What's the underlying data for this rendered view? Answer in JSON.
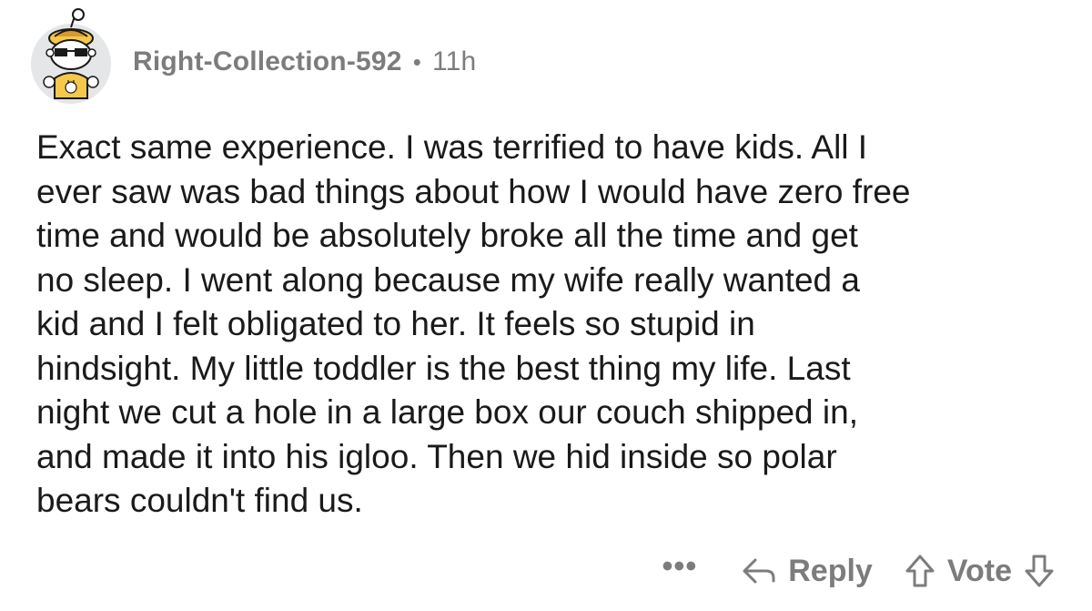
{
  "comment": {
    "author": "Right-Collection-592",
    "separator": "•",
    "age": "11h",
    "body": "Exact same experience. I was terrified to have kids. All I\never saw was bad things about how I would have zero free\ntime and would be absolutely broke all the time and get\nno sleep. I went along because my wife really wanted a\nkid and I felt obligated to her. It feels so stupid in\nhindsight. My little toddler is the best thing my life. Last\nnight we cut a hole in a large box our couch shipped in,\nand made it into his igloo. Then we hid inside so polar\nbears couldn't find us."
  },
  "actions": {
    "more_label": "•••",
    "reply_label": "Reply",
    "vote_label": "Vote"
  },
  "icons": {
    "avatar": "snoo-avatar",
    "reply": "reply-arrow-icon",
    "upvote": "upvote-arrow-icon",
    "downvote": "downvote-arrow-icon"
  },
  "colors": {
    "text": "#1a1a1b",
    "meta": "#7c7c7c",
    "avatar_bg": "#e4e6e8",
    "avatar_accent": "#f5c84b"
  }
}
